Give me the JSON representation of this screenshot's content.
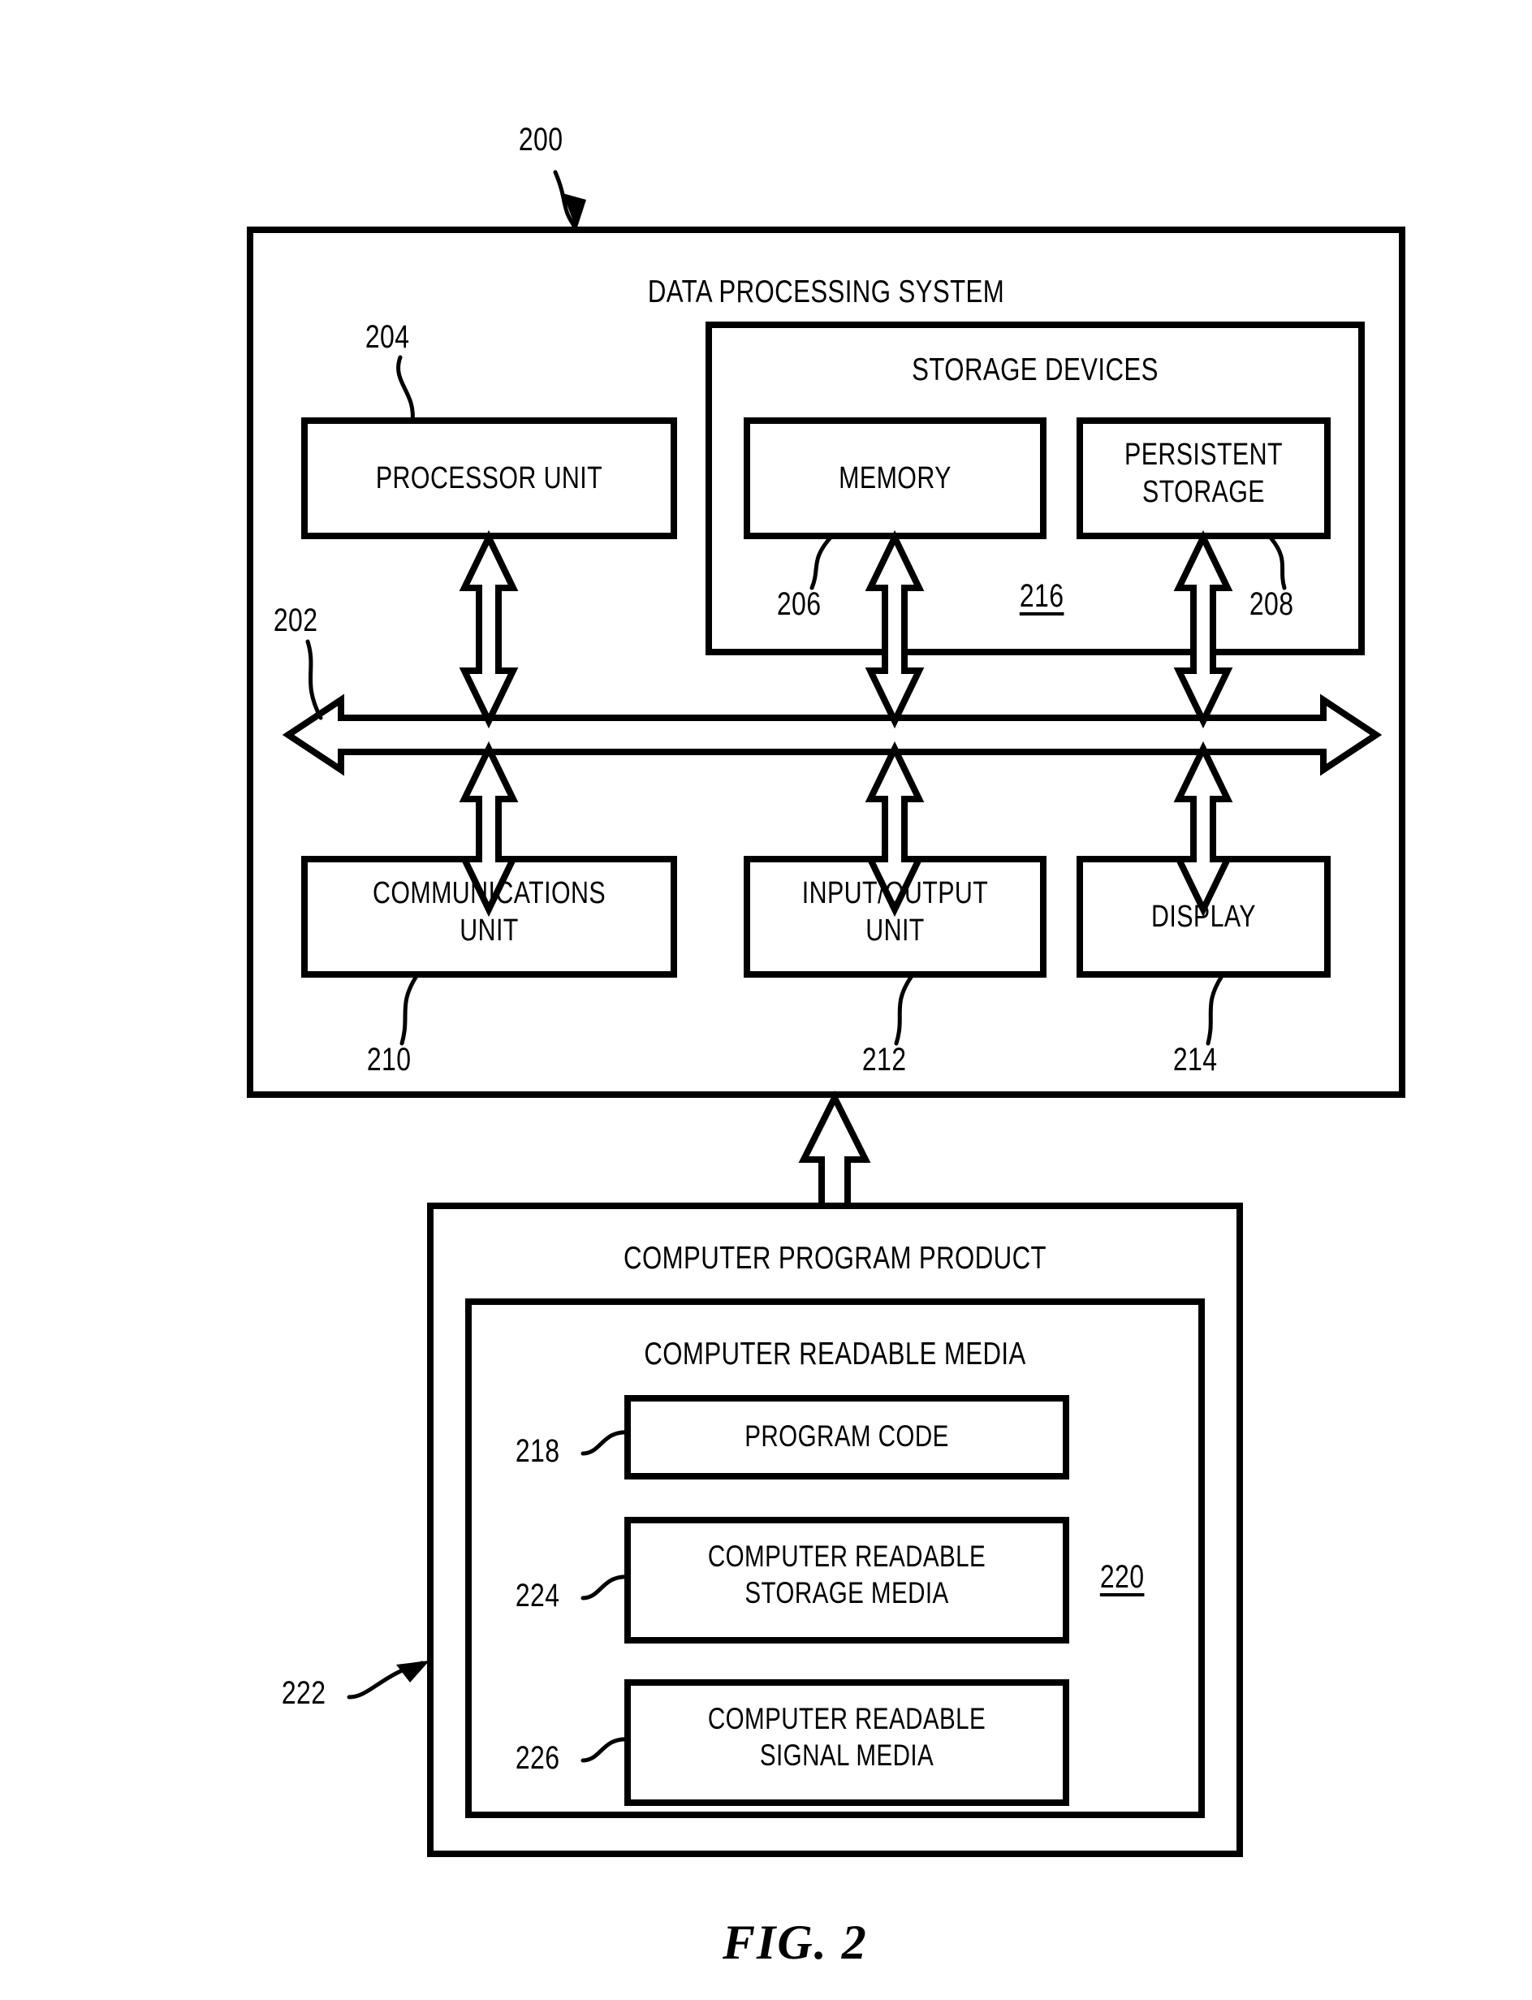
{
  "figure": {
    "caption": "FIG. 2",
    "system_ref": "200"
  },
  "system": {
    "title": "DATA PROCESSING SYSTEM",
    "ref": "200"
  },
  "storage_group": {
    "title": "STORAGE DEVICES",
    "ref": "216"
  },
  "components": {
    "processor": {
      "label": "PROCESSOR UNIT",
      "ref": "204"
    },
    "memory": {
      "label": "MEMORY",
      "ref": "206"
    },
    "persistent_storage": {
      "label": "PERSISTENT\nSTORAGE",
      "ref": "208"
    },
    "communications": {
      "label": "COMMUNICATIONS\nUNIT",
      "ref": "210"
    },
    "input_output": {
      "label": "INPUT/OUTPUT\nUNIT",
      "ref": "212"
    },
    "display": {
      "label": "DISPLAY",
      "ref": "214"
    }
  },
  "bus": {
    "ref": "202"
  },
  "computer_program_product": {
    "title": "COMPUTER PROGRAM PRODUCT",
    "ref": "222"
  },
  "computer_readable_media": {
    "title": "COMPUTER READABLE MEDIA",
    "ref": "220",
    "items": [
      {
        "label": "PROGRAM CODE",
        "ref": "218"
      },
      {
        "label": "COMPUTER READABLE\nSTORAGE MEDIA",
        "ref": "224"
      },
      {
        "label": "COMPUTER READABLE\nSIGNAL MEDIA",
        "ref": "226"
      }
    ]
  },
  "colors": {
    "ink": "#000000",
    "paper": "#ffffff"
  }
}
